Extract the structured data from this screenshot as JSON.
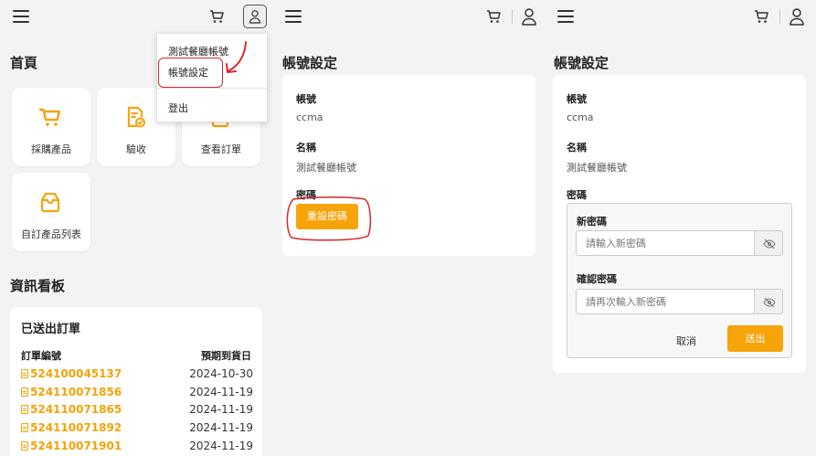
{
  "colors": {
    "accent": "#f7a30a",
    "annotation": "#d9262c",
    "page_bg": "#f3f3f3"
  },
  "icons": [
    "hamburger-icon",
    "cart-icon",
    "user-icon",
    "shopping-cart-icon",
    "checklist-icon",
    "order-icon",
    "box-icon",
    "document-icon",
    "eye-slash-icon"
  ],
  "panel1": {
    "page_title": "首頁",
    "tiles": [
      {
        "label": "採購產品"
      },
      {
        "label": "驗收"
      },
      {
        "label": "查看訂單"
      },
      {
        "label": "自訂產品列表"
      }
    ],
    "user_menu": {
      "account_name": "測試餐廳帳號",
      "account_settings": "帳號設定",
      "logout": "登出"
    },
    "dashboard_title": "資訊看板",
    "orders": {
      "title": "已送出訂單",
      "col_order_no": "訂單編號",
      "col_expected_date": "預期到貨日",
      "rows": [
        {
          "no": "524100045137",
          "date": "2024-10-30"
        },
        {
          "no": "524110071856",
          "date": "2024-11-19"
        },
        {
          "no": "524110071865",
          "date": "2024-11-19"
        },
        {
          "no": "524110071892",
          "date": "2024-11-19"
        },
        {
          "no": "524110071901",
          "date": "2024-11-19"
        }
      ]
    }
  },
  "panel2": {
    "page_title": "帳號設定",
    "account_label": "帳號",
    "account_value": "ccma",
    "name_label": "名稱",
    "name_value": "測試餐廳帳號",
    "password_label": "密碼",
    "reset_button": "重設密碼"
  },
  "panel3": {
    "page_title": "帳號設定",
    "account_label": "帳號",
    "account_value": "ccma",
    "name_label": "名稱",
    "name_value": "測試餐廳帳號",
    "password_label": "密碼",
    "new_password_label": "新密碼",
    "new_password_placeholder": "請輸入新密碼",
    "confirm_password_label": "確認密碼",
    "confirm_password_placeholder": "請再次輸入新密碼",
    "cancel_button": "取消",
    "submit_button": "送出"
  }
}
